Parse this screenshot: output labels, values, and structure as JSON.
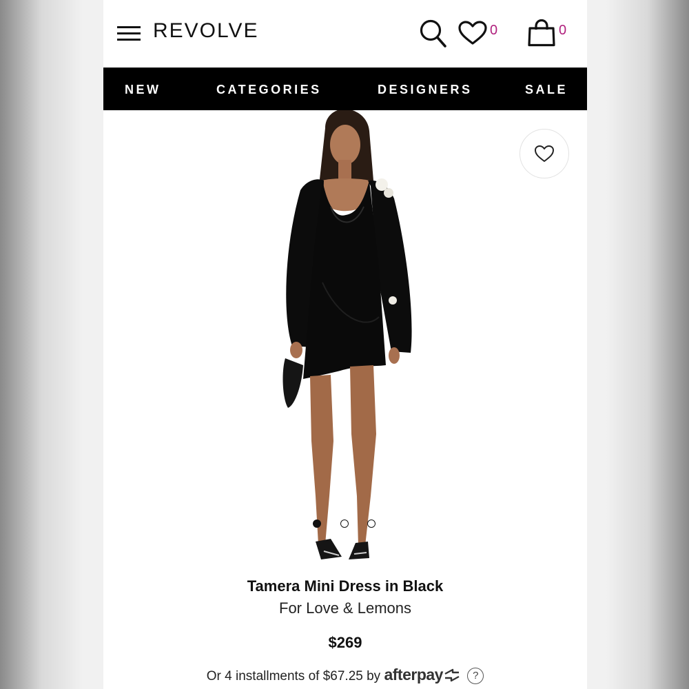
{
  "header": {
    "logo": "REVOLVE",
    "wishlist_count": "0",
    "cart_count": "0",
    "accent_color": "#b0207d"
  },
  "nav": {
    "items": [
      "NEW",
      "CATEGORIES",
      "DESIGNERS",
      "SALE"
    ]
  },
  "gallery": {
    "total_images": 3,
    "active_index": 0
  },
  "product": {
    "name": "Tamera Mini Dress in Black",
    "brand": "For Love & Lemons",
    "price": "$269",
    "installments_text": "Or 4 installments of $67.25 by",
    "installments_provider": "afterpay",
    "help_symbol": "?"
  },
  "icons": {
    "menu": "hamburger-menu-icon",
    "search": "search-icon",
    "wishlist": "heart-icon",
    "cart": "shopping-bag-icon",
    "favorite": "heart-outline-icon",
    "afterpay": "afterpay-arrows-icon"
  }
}
